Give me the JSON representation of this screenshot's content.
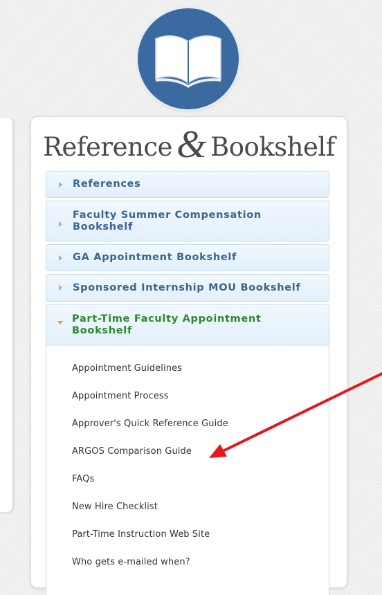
{
  "card": {
    "title_part1": "Reference",
    "title_amp": "&",
    "title_part2": "Bookshelf"
  },
  "accordion": [
    {
      "label": "References",
      "expanded": false
    },
    {
      "label": "Faculty Summer Compensation Bookshelf",
      "expanded": false
    },
    {
      "label": "GA Appointment Bookshelf",
      "expanded": false
    },
    {
      "label": "Sponsored Internship MOU Bookshelf",
      "expanded": false
    },
    {
      "label": "Part-Time Faculty Appointment Bookshelf",
      "expanded": true
    }
  ],
  "links": [
    "Appointment Guidelines",
    "Appointment Process",
    "Approver's Quick Reference Guide",
    "ARGOS Comparison Guide",
    "FAQs",
    "New Hire Checklist",
    "Part-Time Instruction Web Site",
    "Who gets e-mailed when?"
  ],
  "icons": {
    "logo": "open-book-icon",
    "collapsed": "triangle-right-icon",
    "expanded": "triangle-down-icon",
    "annotation": "red-arrow"
  },
  "colors": {
    "logo_circle": "#3a6aa0",
    "header_text": "#39658f",
    "active_header_text": "#2b8a2b",
    "expanded_marker": "#e0a90e",
    "annotation_arrow": "#e8161b"
  }
}
